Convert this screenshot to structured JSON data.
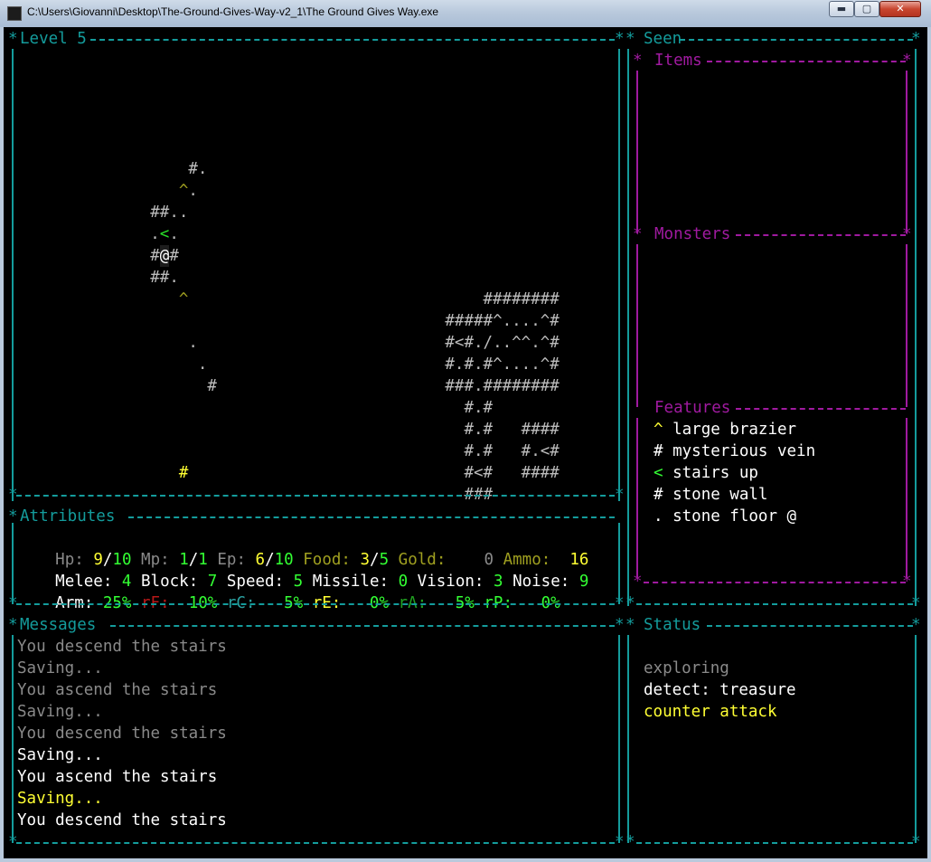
{
  "window": {
    "title": "C:\\Users\\Giovanni\\Desktop\\The-Ground-Gives-Way-v2_1\\The Ground Gives Way.exe",
    "buttons": {
      "minimize": "▬",
      "maximize": "▢",
      "close": "✕"
    }
  },
  "panels": {
    "map": {
      "title": "Level 5"
    },
    "seen": {
      "title": "Seen",
      "items_title": "Items",
      "monsters_title": "Monsters",
      "features_title": "Features"
    },
    "attributes": {
      "title": "Attributes"
    },
    "messages": {
      "title": "Messages"
    },
    "status": {
      "title": "Status"
    }
  },
  "map": {
    "rows": [
      {
        "row": 6,
        "col": 18,
        "text": "#.",
        "color": "gray"
      },
      {
        "row": 7,
        "col": 17,
        "text": "^",
        "color": "olive"
      },
      {
        "row": 7,
        "col": 18,
        "text": ".",
        "color": "gray"
      },
      {
        "row": 8,
        "col": 14,
        "text": "##..",
        "color": "gray"
      },
      {
        "row": 9,
        "col": 14,
        "text": ".",
        "color": "gray"
      },
      {
        "row": 9,
        "col": 15,
        "text": "<",
        "color": "lime"
      },
      {
        "row": 9,
        "col": 16,
        "text": ".",
        "color": "gray"
      },
      {
        "row": 10,
        "col": 14,
        "text": "#",
        "color": "gray"
      },
      {
        "row": 10,
        "col": 15,
        "text": "@",
        "color": "white"
      },
      {
        "row": 10,
        "col": 16,
        "text": "#",
        "color": "gray"
      },
      {
        "row": 11,
        "col": 14,
        "text": "##.",
        "color": "gray"
      },
      {
        "row": 12,
        "col": 17,
        "text": "^",
        "color": "olive"
      },
      {
        "row": 12,
        "col": 49,
        "text": "########",
        "color": "gray"
      },
      {
        "row": 13,
        "col": 45,
        "text": "#####^....^#",
        "color": "gray"
      },
      {
        "row": 14,
        "col": 18,
        "text": ".",
        "color": "gray"
      },
      {
        "row": 14,
        "col": 45,
        "text": "#<#./..^^.^#",
        "color": "gray"
      },
      {
        "row": 15,
        "col": 19,
        "text": ".",
        "color": "gray"
      },
      {
        "row": 15,
        "col": 45,
        "text": "#.#.#^....^#",
        "color": "gray"
      },
      {
        "row": 16,
        "col": 20,
        "text": "#",
        "color": "gray"
      },
      {
        "row": 16,
        "col": 45,
        "text": "###.########",
        "color": "gray"
      },
      {
        "row": 17,
        "col": 47,
        "text": "#.#",
        "color": "gray"
      },
      {
        "row": 18,
        "col": 47,
        "text": "#.#   ####",
        "color": "gray"
      },
      {
        "row": 19,
        "col": 47,
        "text": "#.#   #.<#",
        "color": "gray"
      },
      {
        "row": 20,
        "col": 17,
        "text": "#",
        "color": "yellow"
      },
      {
        "row": 20,
        "col": 47,
        "text": "#<#   ####",
        "color": "gray"
      },
      {
        "row": 21,
        "col": 47,
        "text": "###",
        "color": "gray"
      }
    ]
  },
  "attributes": {
    "hp": {
      "label": "Hp:",
      "cur": "9",
      "max": "10"
    },
    "mp": {
      "label": "Mp:",
      "cur": "1",
      "max": "1"
    },
    "ep": {
      "label": "Ep:",
      "cur": "6",
      "max": "10"
    },
    "food": {
      "label": "Food:",
      "cur": "3",
      "max": "5"
    },
    "gold": {
      "label": "Gold:",
      "value": "0"
    },
    "ammo": {
      "label": "Ammo:",
      "value": "16"
    },
    "melee": {
      "label": "Melee:",
      "value": "4"
    },
    "block": {
      "label": "Block:",
      "value": "7"
    },
    "speed": {
      "label": "Speed:",
      "value": "5"
    },
    "missile": {
      "label": "Missile:",
      "value": "0"
    },
    "vision": {
      "label": "Vision:",
      "value": "3"
    },
    "noise": {
      "label": "Noise:",
      "value": "9"
    },
    "arm": {
      "label": "Arm:",
      "value": "25%"
    },
    "rf": {
      "label": "rF:",
      "value": "10%"
    },
    "rc": {
      "label": "rC:",
      "value": "5%"
    },
    "re": {
      "label": "rE:",
      "value": "0%"
    },
    "ra": {
      "label": "rA:",
      "value": "5%"
    },
    "rp": {
      "label": "rP:",
      "value": "0%"
    }
  },
  "features": [
    {
      "glyph": "^",
      "glyph_color": "yellow",
      "name": "large brazier"
    },
    {
      "glyph": "#",
      "glyph_color": "white",
      "name": "mysterious vein"
    },
    {
      "glyph": "<",
      "glyph_color": "green",
      "name": "stairs up"
    },
    {
      "glyph": "#",
      "glyph_color": "white",
      "name": "stone wall"
    },
    {
      "glyph": ".",
      "glyph_color": "white",
      "name": "stone floor @"
    }
  ],
  "messages": [
    {
      "text": "You descend the stairs",
      "color": "lgray"
    },
    {
      "text": "Saving...",
      "color": "lgray"
    },
    {
      "text": "You ascend the stairs",
      "color": "lgray"
    },
    {
      "text": "Saving...",
      "color": "lgray"
    },
    {
      "text": "You descend the stairs",
      "color": "lgray"
    },
    {
      "text": "Saving...",
      "color": "white"
    },
    {
      "text": "You ascend the stairs",
      "color": "white"
    },
    {
      "text": "Saving...",
      "color": "yellow"
    },
    {
      "text": "You descend the stairs",
      "color": "white"
    }
  ],
  "status": [
    {
      "text": "exploring",
      "color": "lgray"
    },
    {
      "text": "detect: treasure",
      "color": "white"
    },
    {
      "text": "counter attack",
      "color": "yellow"
    }
  ],
  "colors": {
    "border": "#149c9c",
    "seen_border": "#a01aa0",
    "background": "#000000",
    "yellow": "#ffff33",
    "green": "#33ff33",
    "olive": "#a0a020",
    "red": "#b81818"
  }
}
